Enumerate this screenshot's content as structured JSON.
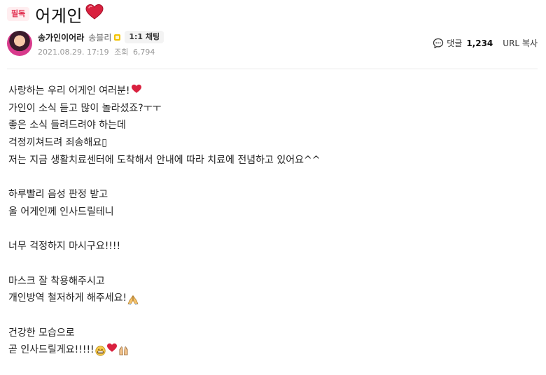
{
  "post": {
    "badge": "필독",
    "title": "어게인",
    "title_emoji": "heart-icon",
    "author": {
      "name": "송가인이어라",
      "grade": "송블리",
      "grade_icon": "grade-icon",
      "chat_label": "1:1 채팅"
    },
    "meta": {
      "date": "2021.08.29. 17:19",
      "views_label": "조회",
      "views": "6,794"
    },
    "actions": {
      "comment_label": "댓글",
      "comment_count": "1,234",
      "url_copy_label": "URL 복사"
    },
    "body": {
      "line1": "사랑하는 우리 어게인 여러분!",
      "line2": "가인이 소식 듣고 많이 놀라셨죠?ㅜㅜ",
      "line3": "좋은 소식 들려드려야 하는데",
      "line4": "걱정끼쳐드려 죄송해요▯",
      "line5": "저는 지금 생활치료센터에 도착해서 안내에 따라 치료에 전념하고 있어요^^",
      "line6": "하루빨리 음성 판정 받고",
      "line7": "울 어게인께 인사드릴테니",
      "line8": "너무 걱정하지 마시구요!!!!",
      "line9": "마스크 잘 착용해주시고",
      "line10": "개인방역 철저하게 해주세요!",
      "line11": "건강한 모습으로",
      "line12": "곧 인사드릴게요!!!!!"
    }
  },
  "colors": {
    "badge_bg": "#ffeef0",
    "badge_text": "#e0284a",
    "heart": "#d9213f",
    "meta_text": "#979797"
  }
}
